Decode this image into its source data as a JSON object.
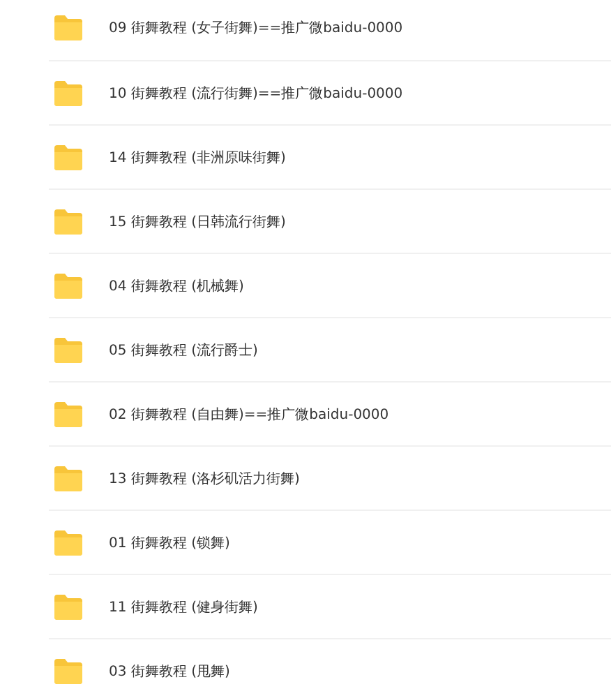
{
  "folders": [
    {
      "name": "09 街舞教程 (女子街舞)==推广微baidu-0000"
    },
    {
      "name": "10 街舞教程 (流行街舞)==推广微baidu-0000"
    },
    {
      "name": "14 街舞教程 (非洲原味街舞)"
    },
    {
      "name": "15 街舞教程 (日韩流行街舞)"
    },
    {
      "name": "04 街舞教程 (机械舞)"
    },
    {
      "name": "05 街舞教程 (流行爵士)"
    },
    {
      "name": "02 街舞教程 (自由舞)==推广微baidu-0000"
    },
    {
      "name": "13 街舞教程 (洛杉矶活力街舞)"
    },
    {
      "name": "01 街舞教程 (锁舞)"
    },
    {
      "name": "11 街舞教程 (健身街舞)"
    },
    {
      "name": "03 街舞教程 (甩舞)"
    }
  ]
}
